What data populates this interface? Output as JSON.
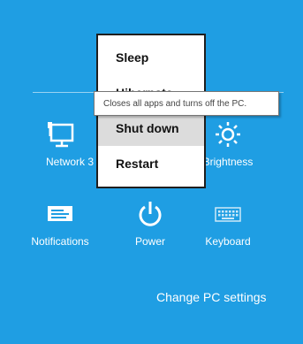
{
  "settings": {
    "network_label": "Network  3",
    "brightness_label": "Brightness",
    "notifications_label": "Notifications",
    "power_label": "Power",
    "keyboard_label": "Keyboard",
    "change_pc_settings": "Change PC settings"
  },
  "power_menu": {
    "items": [
      {
        "label": "Sleep",
        "selected": false
      },
      {
        "label": "Hibernate",
        "selected": false
      },
      {
        "label": "Shut down",
        "selected": true
      },
      {
        "label": "Restart",
        "selected": false
      }
    ]
  },
  "tooltip": {
    "text": "Closes all apps and turns off the PC."
  },
  "colors": {
    "background": "#1f9ee3",
    "menu_background": "#ffffff",
    "menu_selected": "#dcdcdc",
    "menu_border": "#1e1e1e"
  },
  "icons": {
    "network": "network-icon",
    "brightness": "brightness-sun-icon",
    "notifications": "notifications-icon",
    "power": "power-icon",
    "keyboard": "keyboard-icon"
  }
}
